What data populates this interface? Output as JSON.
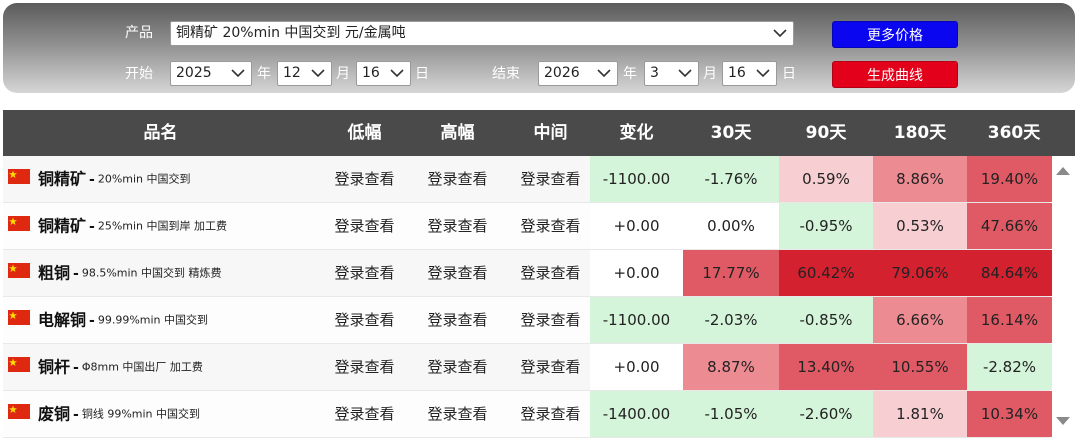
{
  "filter": {
    "product_label": "产品",
    "product_value": "铜精矿 20%min 中国交到 元/金属吨",
    "start_label": "开始",
    "end_label": "结束",
    "start": {
      "year": "2025",
      "month": "12",
      "day": "16"
    },
    "end": {
      "year": "2026",
      "month": "3",
      "day": "16"
    },
    "year_unit": "年",
    "month_unit": "月",
    "day_unit": "日",
    "more_prices_button": "更多价格",
    "generate_curve_button": "生成曲线",
    "colors": {
      "more_button": "#0a07f0",
      "generate_button": "#e2001a"
    }
  },
  "table": {
    "headers": [
      "品名",
      "低幅",
      "高幅",
      "中间",
      "变化",
      "30天",
      "90天",
      "180天",
      "360天"
    ],
    "rows": [
      {
        "name": "铜精矿",
        "spec": "20%min 中国交到",
        "low": "登录查看",
        "high": "登录查看",
        "mid": "登录查看",
        "change": "-1100.00",
        "d30": "-1.76%",
        "d90": "0.59%",
        "d180": "8.86%",
        "d360": "19.40%"
      },
      {
        "name": "铜精矿",
        "spec": "25%min 中国到岸 加工费",
        "low": "登录查看",
        "high": "登录查看",
        "mid": "登录查看",
        "change": "+0.00",
        "d30": "0.00%",
        "d90": "-0.95%",
        "d180": "0.53%",
        "d360": "47.66%"
      },
      {
        "name": "粗铜",
        "spec": "98.5%min 中国交到 精炼费",
        "low": "登录查看",
        "high": "登录查看",
        "mid": "登录查看",
        "change": "+0.00",
        "d30": "17.77%",
        "d90": "60.42%",
        "d180": "79.06%",
        "d360": "84.64%"
      },
      {
        "name": "电解铜",
        "spec": "99.99%min 中国交到",
        "low": "登录查看",
        "high": "登录查看",
        "mid": "登录查看",
        "change": "-1100.00",
        "d30": "-2.03%",
        "d90": "-0.85%",
        "d180": "6.66%",
        "d360": "16.14%"
      },
      {
        "name": "铜杆",
        "spec": "Φ8mm 中国出厂 加工费",
        "low": "登录查看",
        "high": "登录查看",
        "mid": "登录查看",
        "change": "+0.00",
        "d30": "8.87%",
        "d90": "13.40%",
        "d180": "10.55%",
        "d360": "-2.82%"
      },
      {
        "name": "废铜",
        "spec": "铜线 99%min 中国交到",
        "low": "登录查看",
        "high": "登录查看",
        "mid": "登录查看",
        "change": "-1400.00",
        "d30": "-1.05%",
        "d90": "-2.60%",
        "d180": "1.81%",
        "d360": "10.34%"
      }
    ]
  },
  "colors": {
    "neutral": "#ffffff",
    "neg_light": "#d4f5da",
    "pos_light": "#f7cfd3",
    "pos_mid": "#ed8b93",
    "pos_strong": "#e05a65",
    "pos_max": "#d4212f",
    "header_bg": "#4a4a4a"
  },
  "icons": {
    "flag": "china-flag-icon",
    "dropdown": "chevron-down-icon",
    "scroll_up": "triangle-up-icon",
    "scroll_down": "triangle-down-icon"
  }
}
